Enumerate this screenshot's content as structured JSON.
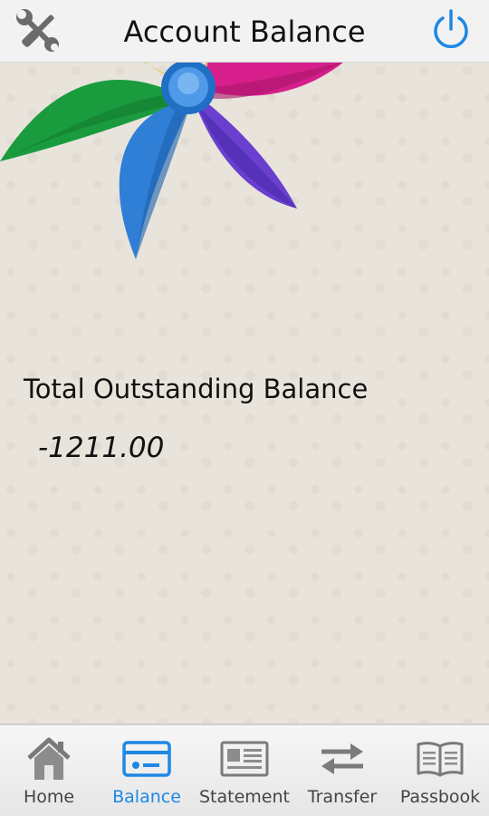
{
  "header": {
    "title": "Account Balance",
    "settings_icon": "tools-icon",
    "power_icon": "power-icon",
    "power_color": "#1e88e5"
  },
  "decoration": {
    "image": "pinwheel",
    "colors": [
      "#f4c20d",
      "#1a9c3e",
      "#2f7fd6",
      "#6a3fcf",
      "#d61f8a",
      "#f57c22"
    ]
  },
  "balance": {
    "label": "Total Outstanding Balance",
    "value": "-1211.00"
  },
  "bottom_nav": {
    "active_color": "#1e88e5",
    "items": [
      {
        "label": "Home",
        "icon": "home-icon"
      },
      {
        "label": "Balance",
        "icon": "balance-card-icon",
        "active": true
      },
      {
        "label": "Statement",
        "icon": "statement-icon"
      },
      {
        "label": "Transfer",
        "icon": "transfer-arrows-icon"
      },
      {
        "label": "Passbook",
        "icon": "passbook-icon"
      }
    ]
  }
}
